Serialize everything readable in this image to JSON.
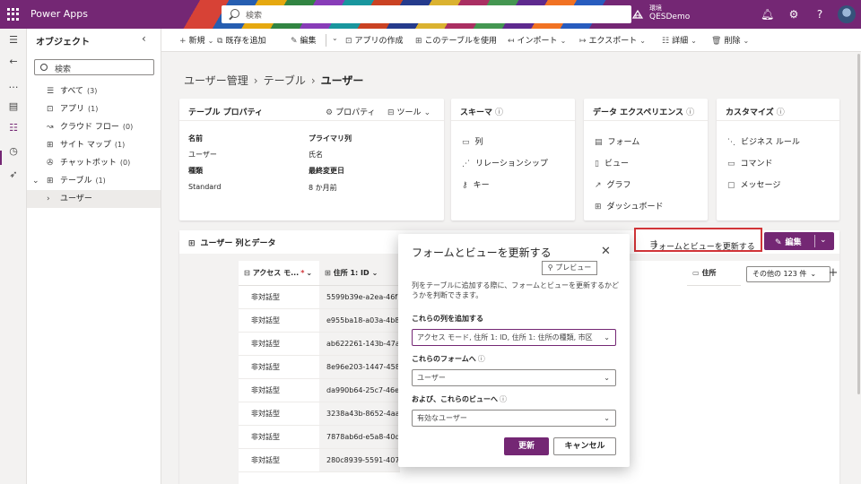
{
  "topbar": {
    "app_name": "Power Apps",
    "search_placeholder": "検索",
    "env_label": "環境",
    "env_name": "QESDemo",
    "icons": [
      "waffle-icon",
      "search-icon",
      "environment-icon",
      "bell-icon",
      "gear-icon",
      "help-icon",
      "avatar"
    ]
  },
  "object_panel": {
    "title": "オブジェクト",
    "search_placeholder": "検索",
    "items": [
      {
        "label": "すべて",
        "count": "(3)",
        "icon": "list-icon"
      },
      {
        "label": "アプリ",
        "count": "(1)",
        "icon": "app-icon"
      },
      {
        "label": "クラウド フロー",
        "count": "(0)",
        "icon": "flow-icon"
      },
      {
        "label": "サイト マップ",
        "count": "(1)",
        "icon": "sitemap-icon"
      },
      {
        "label": "チャットボット",
        "count": "(0)",
        "icon": "chatbot-icon"
      },
      {
        "label": "テーブル",
        "count": "(1)",
        "icon": "table-icon"
      },
      {
        "label": "ユーザー",
        "count": "",
        "icon": "chevron-right-icon"
      }
    ]
  },
  "command_bar": {
    "new": "新規",
    "add_existing": "既存を追加",
    "edit": "編集",
    "create_app": "アプリの作成",
    "use_table": "このテーブルを使用",
    "import": "インポート",
    "export": "エクスポート",
    "details": "詳細",
    "delete": "削除"
  },
  "breadcrumb": [
    "ユーザー管理",
    "テーブル",
    "ユーザー"
  ],
  "table_properties": {
    "title": "テーブル プロパティ",
    "properties_action": "プロパティ",
    "tools_action": "ツール",
    "name_label": "名前",
    "name_value": "ユーザー",
    "primary_label": "プライマリ列",
    "primary_value": "氏名",
    "type_label": "種類",
    "type_value": "Standard",
    "modified_label": "最終変更日",
    "modified_value": "8 か月前"
  },
  "schema": {
    "title": "スキーマ",
    "items": [
      "列",
      "リレーションシップ",
      "キー"
    ]
  },
  "data_experiences": {
    "title": "データ エクスペリエンス",
    "items": [
      "フォーム",
      "ビュー",
      "グラフ",
      "ダッシュボード"
    ]
  },
  "customizations": {
    "title": "カスタマイズ",
    "items": [
      "ビジネス ルール",
      "コマンド",
      "メッセージ"
    ]
  },
  "data_section": {
    "title": "ユーザー 列とデータ",
    "update_button": "フォームとビューを更新する",
    "edit_button": "編集",
    "col_a_header": "アクセス モ...",
    "col_b_header": "住所 1: ID",
    "col_addr_frag": "住所",
    "more_cols": "その他の 123 件",
    "rows": [
      {
        "a": "非対話型",
        "b": "5599b39e-a2ea-46f7"
      },
      {
        "a": "非対話型",
        "b": "e955ba18-a03a-4b8"
      },
      {
        "a": "非対話型",
        "b": "ab622261-143b-47a"
      },
      {
        "a": "非対話型",
        "b": "8e96e203-1447-458"
      },
      {
        "a": "非対話型",
        "b": "da990b64-25c7-46e"
      },
      {
        "a": "非対話型",
        "b": "3238a43b-8652-4aa"
      },
      {
        "a": "非対話型",
        "b": "7878ab6d-e5a8-40d"
      },
      {
        "a": "非対話型",
        "b": "280c8939-5591-4079"
      }
    ]
  },
  "dialog": {
    "title": "フォームとビューを更新する",
    "preview": "プレビュー",
    "description": "列をテーブルに追加する際に、フォームとビューを更新するかどうかを判断できます。",
    "columns_label": "これらの列を追加する",
    "columns_value": "アクセス モード, 住所 1: ID, 住所 1: 住所の種類, 市区",
    "forms_label": "これらのフォームへ",
    "forms_value": "ユーザー",
    "views_label": "および、これらのビューへ",
    "views_value": "有効なユーザー",
    "update": "更新",
    "cancel": "キャンセル"
  },
  "colors": {
    "brand": "#742774",
    "highlight": "#d13438"
  }
}
